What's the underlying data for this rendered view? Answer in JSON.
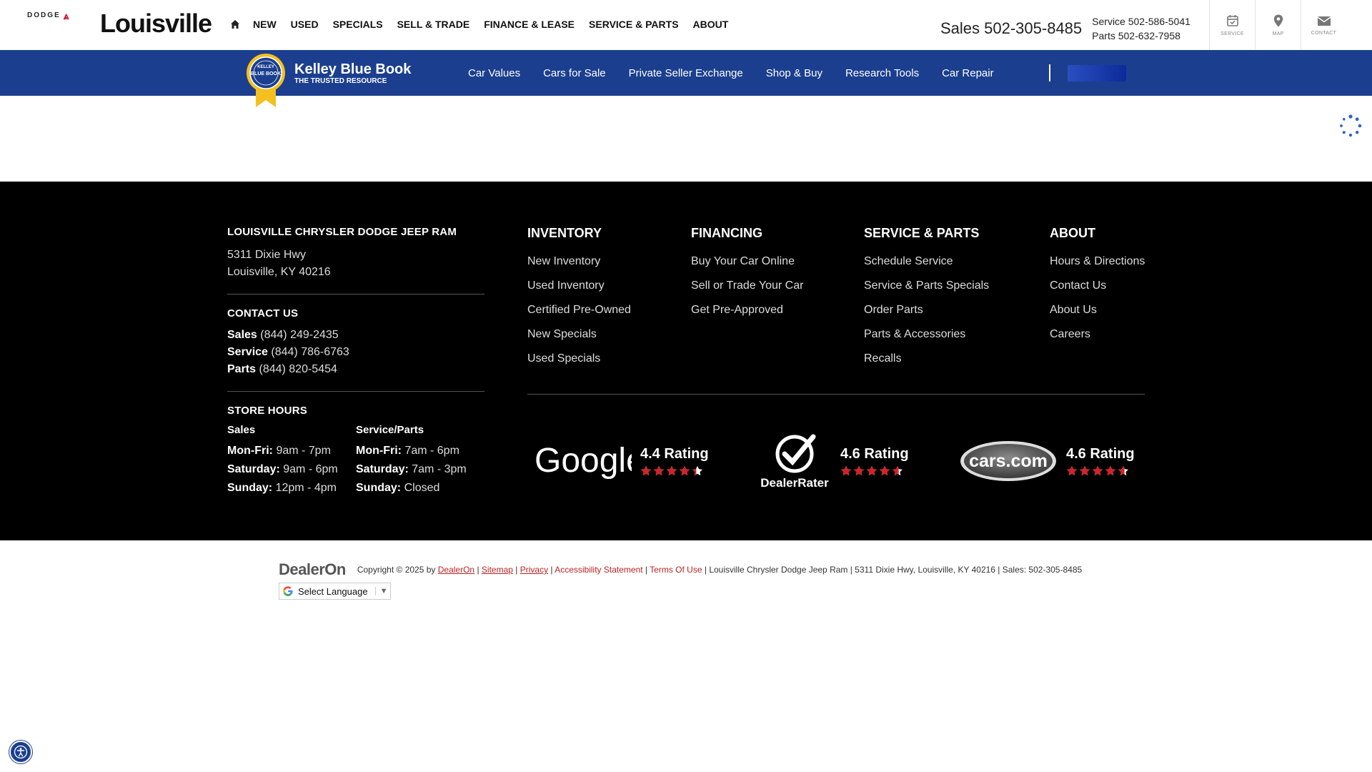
{
  "header": {
    "brand_small": "DODGE",
    "brand_main": "Louisville",
    "nav": [
      "NEW",
      "USED",
      "SPECIALS",
      "SELL & TRADE",
      "FINANCE & LEASE",
      "SERVICE & PARTS",
      "ABOUT"
    ],
    "sales_phone": "Sales 502-305-8485",
    "service_phone_label": "Service",
    "service_phone": "502-586-5041",
    "parts_phone_label": "Parts",
    "parts_phone": "502-632-7958",
    "utility": [
      "SERVICE",
      "MAP",
      "CONTACT"
    ]
  },
  "kbb": {
    "title": "Kelley Blue Book",
    "subtitle": "THE TRUSTED RESOURCE",
    "links": [
      "Car Values",
      "Cars for Sale",
      "Private Seller Exchange",
      "Shop & Buy",
      "Research Tools",
      "Car Repair"
    ]
  },
  "footer": {
    "dealer_name": "LOUISVILLE CHRYSLER DODGE JEEP RAM",
    "address_line1": "5311 Dixie Hwy",
    "address_line2": "Louisville, KY 40216",
    "contact_heading": "CONTACT US",
    "contacts": [
      {
        "label": "Sales",
        "value": "(844) 249-2435"
      },
      {
        "label": "Service",
        "value": "(844) 786-6763"
      },
      {
        "label": "Parts",
        "value": "(844) 820-5454"
      }
    ],
    "hours_heading": "STORE HOURS",
    "hours": [
      {
        "title": "Sales",
        "rows": [
          {
            "day": "Mon-Fri:",
            "time": "9am - 7pm"
          },
          {
            "day": "Saturday:",
            "time": "9am - 6pm"
          },
          {
            "day": "Sunday:",
            "time": "12pm - 4pm"
          }
        ]
      },
      {
        "title": "Service/Parts",
        "rows": [
          {
            "day": "Mon-Fri:",
            "time": "7am - 6pm"
          },
          {
            "day": "Saturday:",
            "time": "7am - 3pm"
          },
          {
            "day": "Sunday:",
            "time": "Closed"
          }
        ]
      }
    ],
    "columns": [
      {
        "title": "INVENTORY",
        "links": [
          "New Inventory",
          "Used Inventory",
          "Certified Pre-Owned",
          "New Specials",
          "Used Specials"
        ]
      },
      {
        "title": "FINANCING",
        "links": [
          "Buy Your Car Online",
          "Sell or Trade Your Car",
          "Get Pre-Approved"
        ]
      },
      {
        "title": "SERVICE & PARTS",
        "links": [
          "Schedule Service",
          "Service & Parts Specials",
          "Order Parts",
          "Parts & Accessories",
          "Recalls"
        ]
      },
      {
        "title": "ABOUT",
        "links": [
          "Hours & Directions",
          "Contact Us",
          "About Us",
          "Careers"
        ]
      }
    ],
    "ratings": [
      {
        "source": "Google",
        "score": "4.4 Rating",
        "stars": 4.4
      },
      {
        "source": "DealerRater",
        "score": "4.6 Rating",
        "stars": 4.6
      },
      {
        "source": "cars.com",
        "score": "4.6 Rating",
        "stars": 4.6
      }
    ]
  },
  "legal": {
    "logo": "DealerOn",
    "copyright": "Copyright © 2025 by",
    "dealeron_link": "DealerOn",
    "sitemap": "Sitemap",
    "privacy": "Privacy",
    "accessibility": "Accessibility Statement",
    "terms": "Terms Of Use",
    "tail": "Louisville Chrysler Dodge Jeep Ram |  5311 Dixie Hwy, Louisville, KY 40216 | Sales: 502-305-8485",
    "language": "Select Language"
  },
  "colors": {
    "kbb_blue": "#1b3f8e",
    "star_red": "#d3222a",
    "footer_bg": "#000000"
  }
}
